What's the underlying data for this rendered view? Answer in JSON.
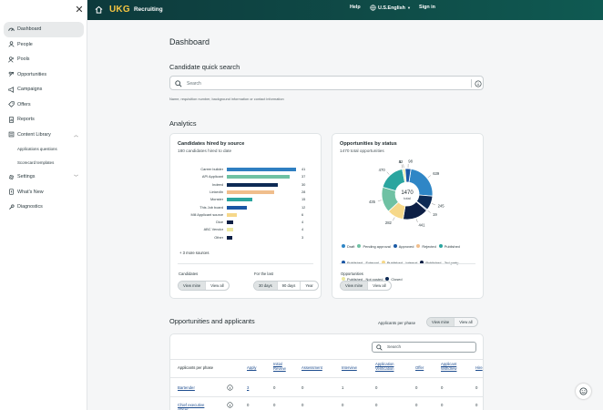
{
  "app": {
    "logo": "UKG",
    "product": "Recruiting"
  },
  "header": {
    "help": "Help",
    "language": "U.S.English",
    "signin": "Sign in"
  },
  "sidebar": {
    "items": [
      {
        "label": "Dashboard",
        "icon": "dashboard-icon"
      },
      {
        "label": "People",
        "icon": "people-icon"
      },
      {
        "label": "Pools",
        "icon": "pools-icon"
      },
      {
        "label": "Opportunities",
        "icon": "opportunities-icon"
      },
      {
        "label": "Campaigns",
        "icon": "megaphone-icon"
      },
      {
        "label": "Offers",
        "icon": "offers-icon"
      },
      {
        "label": "Reports",
        "icon": "reports-icon"
      },
      {
        "label": "Content Library",
        "icon": "library-icon"
      },
      {
        "label": "Settings",
        "icon": "gear-icon"
      },
      {
        "label": "What's New",
        "icon": "whats-new-icon"
      },
      {
        "label": "Diagnostics",
        "icon": "wrench-icon"
      }
    ],
    "subitems": [
      "Applications questions",
      "Scorecard templates"
    ]
  },
  "main": {
    "title": "Dashboard",
    "search_title": "Candidate quick search",
    "search_placeholder": "Search",
    "search_hint": "Name, requisition number, background information or contact information",
    "analytics_title": "Analytics",
    "opp_apps_title": "Opportunities and applicants"
  },
  "hired_card": {
    "title": "Candidates hired by source",
    "subtitle": "180 candidates hired to date",
    "more": "+ 3 more sources",
    "candidates_label": "Candidates",
    "for_last_label": "For the last",
    "view_mine": "View mine",
    "view_all": "View all",
    "d30": "30 days",
    "d90": "90 days",
    "year": "Year"
  },
  "status_card": {
    "title": "Opportunities by status",
    "subtitle": "1470 total opportunities",
    "center_value": "1470",
    "center_label": "total",
    "opp_label": "Opportunities",
    "view_mine": "View mine",
    "view_all": "View all"
  },
  "table": {
    "per_phase_label": "Applicants per phase",
    "view_mine": "View mine",
    "view_all": "View all",
    "search_placeholder": "Search",
    "headers": [
      "Applicants per phase",
      "Apply",
      "Initial Review",
      "Assessment",
      "Interview",
      "Application Verification",
      "Offer",
      "Applicant Withdrew",
      "Hire"
    ],
    "rows": [
      {
        "name": "Bartender",
        "values": [
          "3",
          "0",
          "0",
          "1",
          "0",
          "0",
          "0",
          "0"
        ]
      },
      {
        "name": "Chief executive officer",
        "values": [
          "0",
          "0",
          "0",
          "0",
          "0",
          "0",
          "0",
          "0"
        ]
      }
    ]
  },
  "chart_data": [
    {
      "type": "bar",
      "title": "Candidates hired by source",
      "categories": [
        "Career builder",
        "API Applicant",
        "Indeed",
        "LinkedIn",
        "Monster",
        "This Job board",
        "Mill Applicant source",
        "Dice",
        "ABC Vendor",
        "Other"
      ],
      "values": [
        41,
        37,
        30,
        28,
        15,
        12,
        6,
        4,
        4,
        3
      ],
      "colors": [
        "#2f7fc1",
        "#6fc1a3",
        "#0d2a55",
        "#f0be8c",
        "#2aa59f",
        "#1a56a5",
        "#f6d88a",
        "#0d1f45",
        "#ece8a0",
        "#0d1f45"
      ],
      "xlim": [
        0,
        41
      ]
    },
    {
      "type": "pie",
      "title": "Opportunities by status",
      "total": 1470,
      "slices": [
        {
          "label": "Draft",
          "value": 639,
          "color": "#2f86c6"
        },
        {
          "label": "Pending approval",
          "value": 245,
          "color": "#0d2a55"
        },
        {
          "label": "Approved",
          "value": 19,
          "color": "#1b5aa6"
        },
        {
          "label": "Rejected",
          "value": 441,
          "color": "#0d1f45"
        },
        {
          "label": "Published",
          "value": 282,
          "color": "#f6d88a"
        },
        {
          "label": "Published - External",
          "value": 435,
          "color": "#6fc1a3"
        },
        {
          "label": "Published - Internal",
          "value": 470,
          "color": "#2aa59f"
        },
        {
          "label": "Published - 3rd party",
          "value": 5,
          "color": "#0d2a55"
        },
        {
          "label": "Published - Not posted",
          "value": 42,
          "color": "#ece8a0"
        },
        {
          "label": "Closed",
          "value": 98,
          "color": "#1a56a5"
        }
      ],
      "legend": [
        {
          "label": "Draft",
          "color": "#2f86c6"
        },
        {
          "label": "Pending approval",
          "color": "#6fc1a3"
        },
        {
          "label": "Approved",
          "color": "#1b5aa6"
        },
        {
          "label": "Rejected",
          "color": "#f0be8c"
        },
        {
          "label": "Published",
          "color": "#2aa59f"
        },
        {
          "label": "Published - External",
          "color": "#1a56a5"
        },
        {
          "label": "Published - Internal",
          "color": "#f6d88a"
        },
        {
          "label": "Published - 3rd party",
          "color": "#0d1f45"
        },
        {
          "label": "Published - Not posted",
          "color": "#ece8a0"
        },
        {
          "label": "Closed",
          "color": "#0d2a55"
        }
      ]
    }
  ]
}
